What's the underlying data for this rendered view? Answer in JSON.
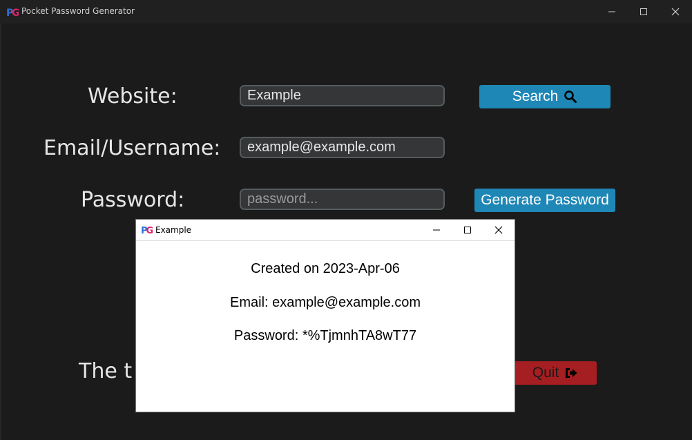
{
  "window": {
    "title": "Pocket Password Generator",
    "logo_text": "PG"
  },
  "form": {
    "website_label": "Website:",
    "website_value": "Example",
    "email_label": "Email/Username:",
    "email_value": "example@example.com",
    "password_label": "Password:",
    "password_placeholder": "password...",
    "search_label": "Search",
    "generate_label": "Generate Password",
    "footer_text": "The t",
    "quit_label": "Quit"
  },
  "dialog": {
    "title": "Example",
    "created": "Created on 2023-Apr-06",
    "email": "Email: example@example.com",
    "password": "Password: *%TjmnhTA8wT77"
  },
  "colors": {
    "background": "#1b1b1b",
    "titlebar": "#202020",
    "entry_bg": "#343638",
    "entry_border": "#565b5e",
    "accent_button": "#1f87b6",
    "quit_button": "#a51e21"
  },
  "icons": {
    "search": "search-icon",
    "quit": "sign-out-icon",
    "minimize": "minimize-icon",
    "maximize": "maximize-icon",
    "close": "close-icon"
  }
}
